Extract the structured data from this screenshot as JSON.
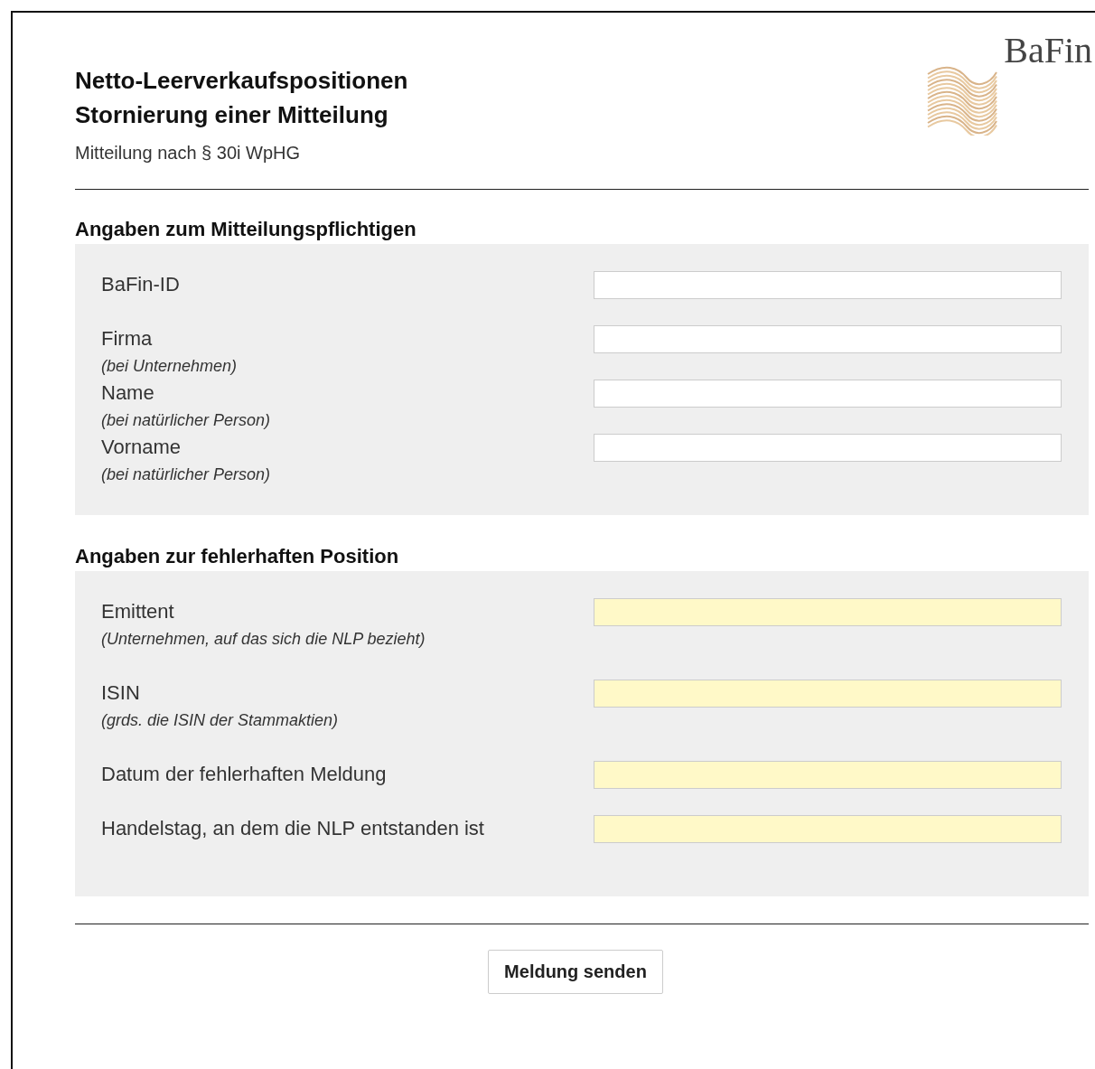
{
  "header": {
    "title_lines": [
      "Netto-Leerverkaufspositionen",
      "Stornierung einer Mitteilung"
    ],
    "subtitle": "Mitteilung nach § 30i WpHG",
    "logo_text": "BaFin"
  },
  "sections": [
    {
      "heading": "Angaben zum Mitteilungspflichtigen",
      "kind": "compact",
      "fields": [
        {
          "label": "BaFin-ID",
          "required": false
        },
        {
          "label": "Firma",
          "hint": "(bei Unternehmen)",
          "required": false
        },
        {
          "label": "Name",
          "hint": "(bei natürlicher Person)",
          "required": false
        },
        {
          "label": "Vorname",
          "hint": "(bei natürlicher Person)",
          "required": false
        }
      ]
    },
    {
      "heading": "Angaben zur fehlerhaften Position",
      "kind": "spaced",
      "fields": [
        {
          "label": "Emittent",
          "hint": "(Unternehmen, auf das sich die NLP bezieht)",
          "required": true
        },
        {
          "label": "ISIN",
          "hint": "(grds. die ISIN der Stammaktien)",
          "required": true
        },
        {
          "label": "Datum der fehlerhaften Meldung",
          "required": true
        },
        {
          "label": "Handelstag, an dem die NLP entstanden ist",
          "required": true
        }
      ]
    }
  ],
  "submit_button": "Meldung senden"
}
